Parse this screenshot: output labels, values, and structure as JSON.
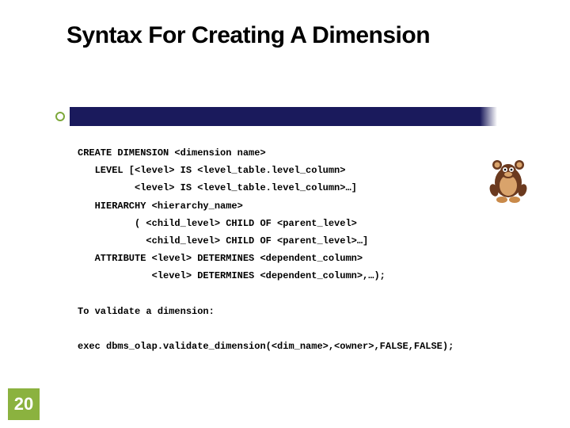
{
  "title": "Syntax For Creating A Dimension",
  "code": "CREATE DIMENSION <dimension name>\n   LEVEL [<level> IS <level_table.level_column>\n          <level> IS <level_table.level_column>…]\n   HIERARCHY <hierarchy_name>\n          ( <child_level> CHILD OF <parent_level>\n            <child_level> CHILD OF <parent_level>…]\n   ATTRIBUTE <level> DETERMINES <dependent_column>\n             <level> DETERMINES <dependent_column>,…);\n\nTo validate a dimension:\n\nexec dbms_olap.validate_dimension(<dim_name>,<owner>,FALSE,FALSE);",
  "page_number": "20"
}
